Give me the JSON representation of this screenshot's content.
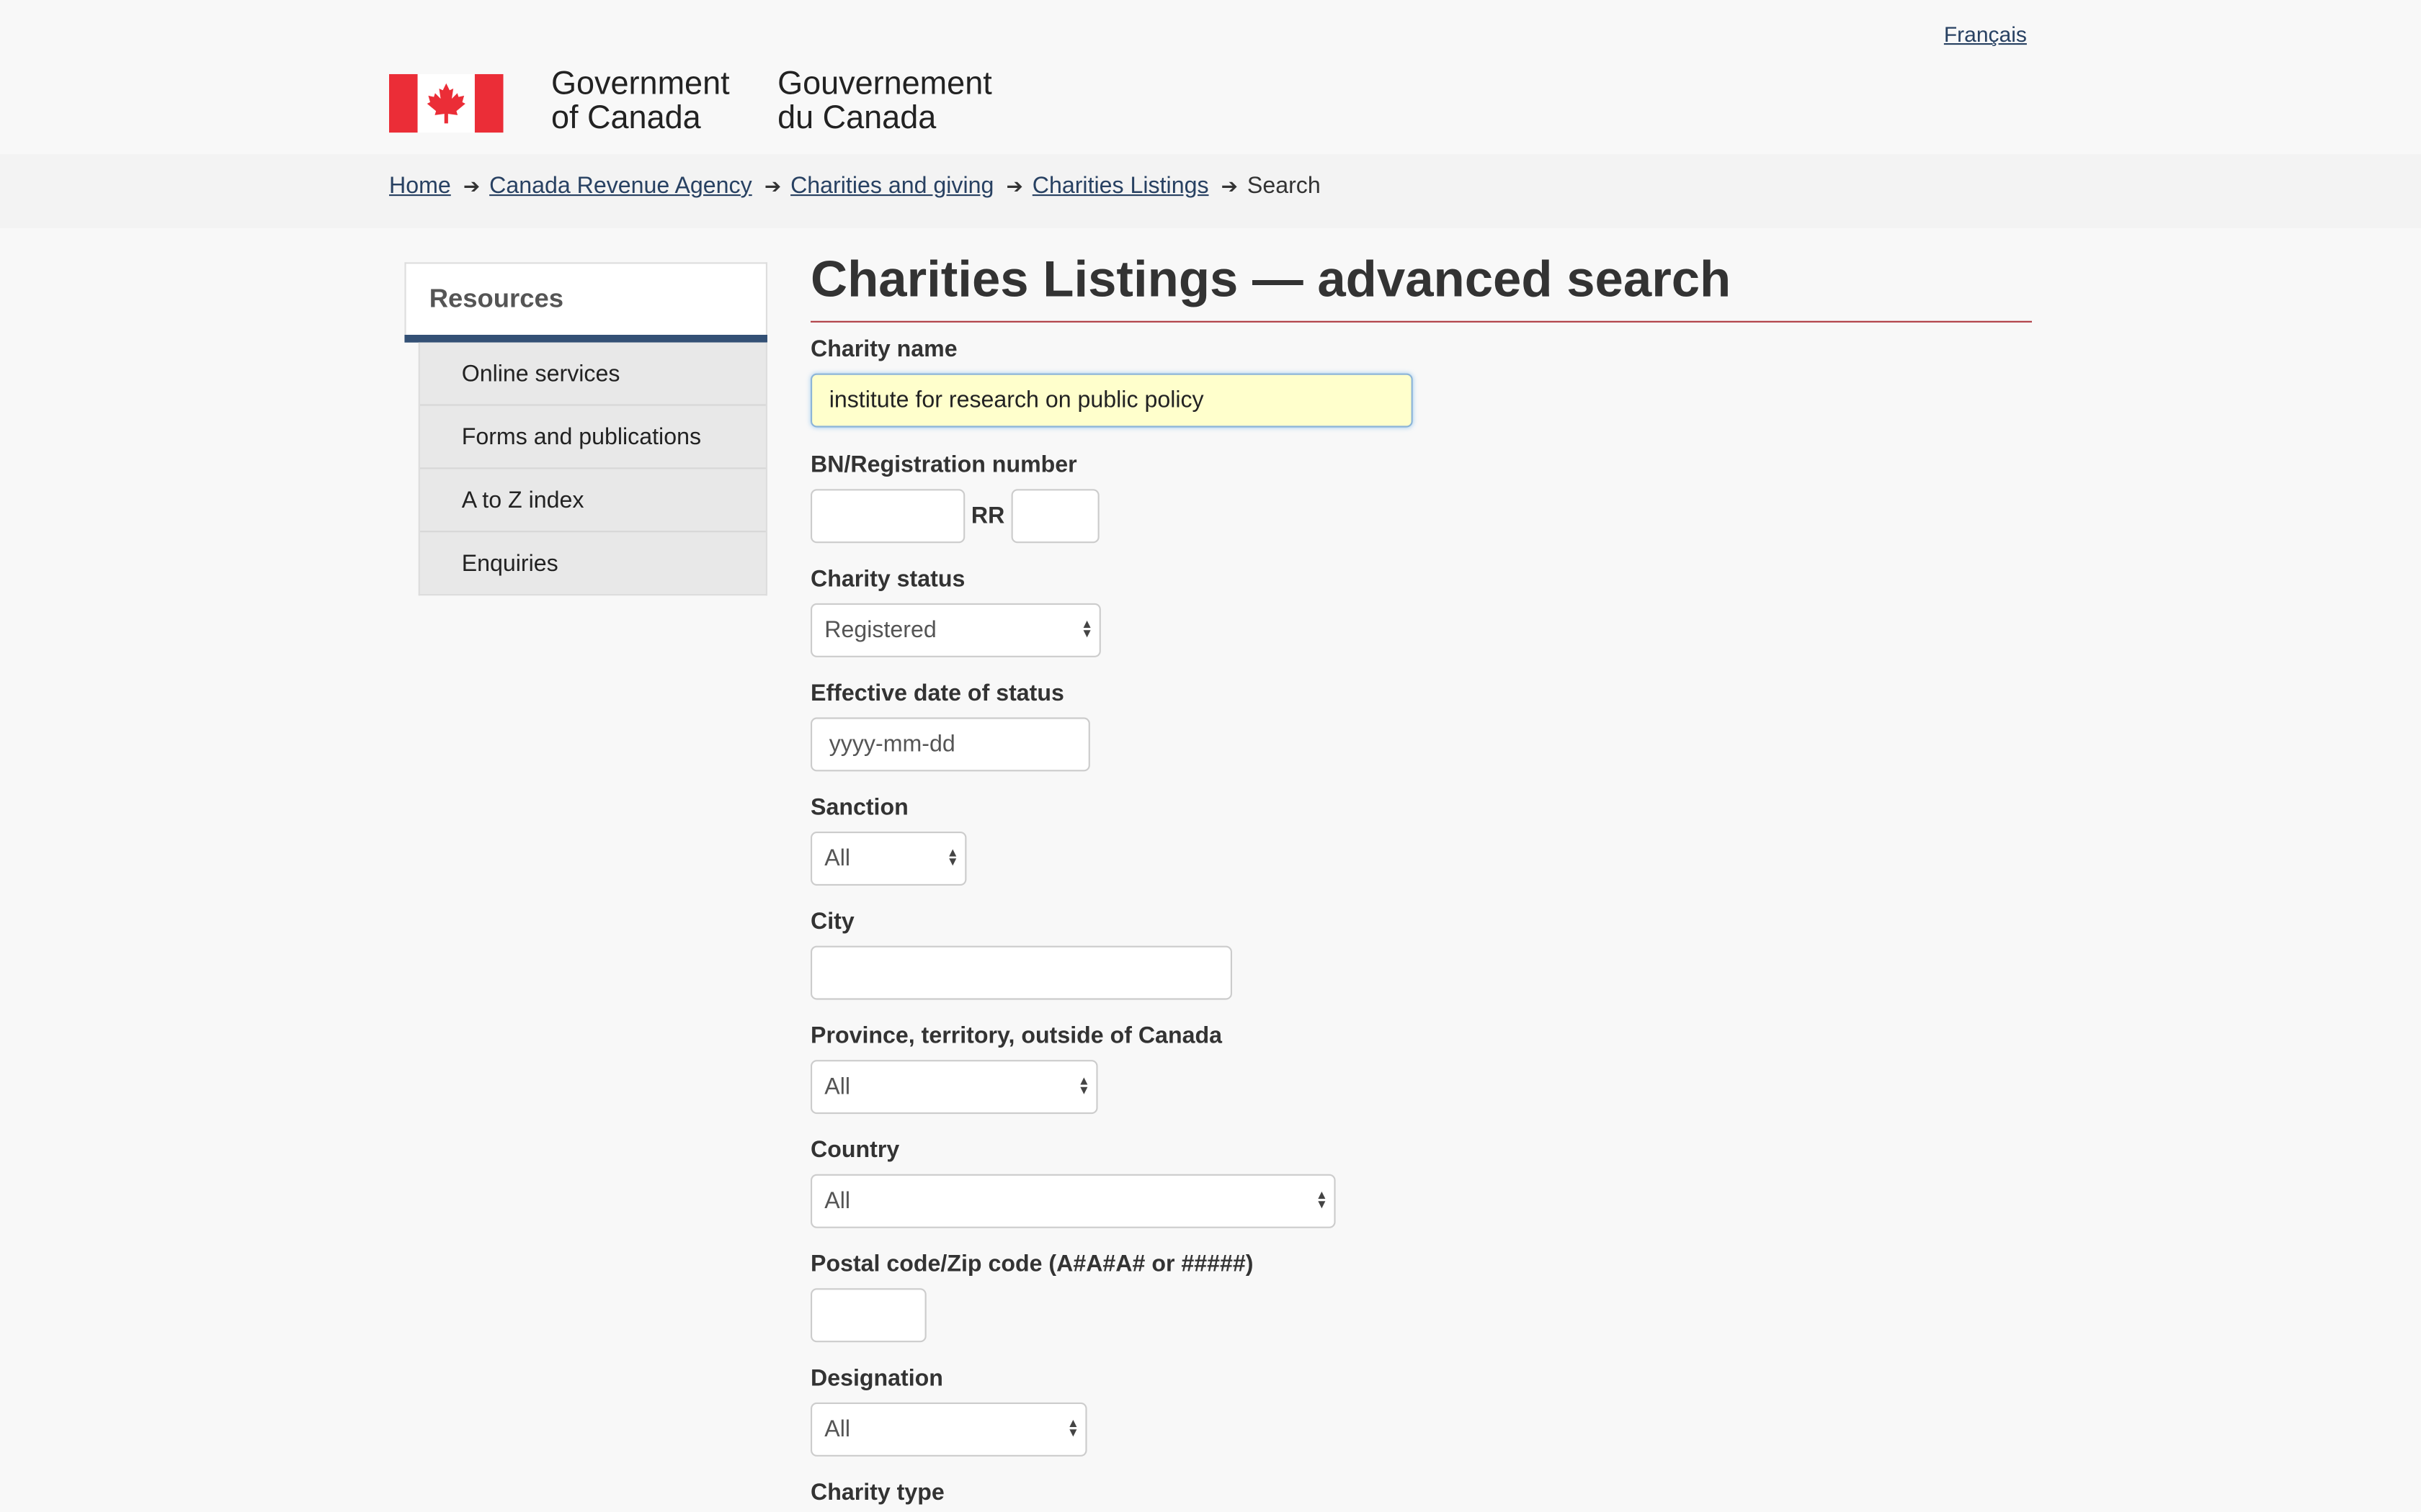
{
  "header": {
    "language_link": "Français",
    "signature_en": [
      "Government",
      "of Canada"
    ],
    "signature_fr": [
      "Gouvernement",
      "du Canada"
    ],
    "flag_colors": {
      "red": "#eb2d37",
      "white": "#ffffff"
    }
  },
  "breadcrumb": {
    "items": [
      "Home",
      "Canada Revenue Agency",
      "Charities and giving",
      "Charities Listings"
    ],
    "current": "Search"
  },
  "sidebar": {
    "heading": "Resources",
    "items": [
      "Online services",
      "Forms and publications",
      "A to Z index",
      "Enquiries"
    ]
  },
  "main": {
    "title": "Charities Listings — advanced search",
    "charity_name": {
      "label": "Charity name",
      "value": "institute for research on public policy"
    },
    "bn": {
      "label": "BN/Registration number",
      "separator": "RR",
      "value1": "",
      "value2": ""
    },
    "charity_status": {
      "label": "Charity status",
      "selected": "Registered"
    },
    "effective_date": {
      "label": "Effective date of status",
      "placeholder": "yyyy-mm-dd"
    },
    "sanction": {
      "label": "Sanction",
      "selected": "All"
    },
    "city": {
      "label": "City",
      "value": ""
    },
    "province": {
      "label": "Province, territory, outside of Canada",
      "selected": "All"
    },
    "country": {
      "label": "Country",
      "selected": "All"
    },
    "postal": {
      "label": "Postal code/Zip code (A#A#A# or #####)",
      "value": ""
    },
    "designation": {
      "label": "Designation",
      "selected": "All"
    },
    "charity_type": {
      "label": "Charity type"
    }
  },
  "colors": {
    "link": "#284162",
    "title_rule": "#af3c43",
    "sidebar_rule": "#335075",
    "highlight_input": "#ffffcc"
  }
}
